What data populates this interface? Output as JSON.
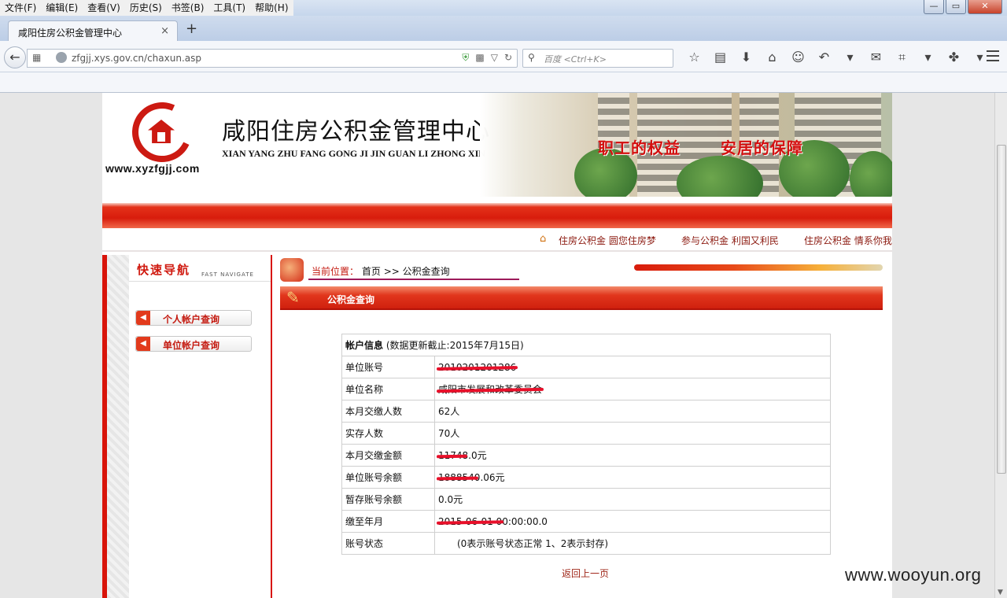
{
  "browser": {
    "menu": [
      "文件(F)",
      "编辑(E)",
      "查看(V)",
      "历史(S)",
      "书签(B)",
      "工具(T)",
      "帮助(H)"
    ],
    "window_controls": {
      "minimize": "—",
      "restore": "▭",
      "close": "✕"
    },
    "tab_title": "咸阳住房公积金管理中心",
    "tab_close": "×",
    "new_tab": "+",
    "url": "zfgjj.xys.gov.cn/chaxun.asp",
    "search_placeholder": "百度 <Ctrl+K>",
    "toolbar_icons": [
      "bookmark-star-icon",
      "reading-list-icon",
      "download-icon",
      "home-icon",
      "emoji-icon",
      "undo-icon",
      "dropdown-icon",
      "chat-icon",
      "crop-icon",
      "dropdown-icon",
      "extension-icon",
      "dropdown-icon"
    ]
  },
  "site": {
    "url_text": "www.xyzfgjj.com",
    "title": "咸阳住房公积金管理中心",
    "pinyin": "XIAN YANG ZHU FANG GONG JI JIN GUAN LI ZHONG XIN",
    "slogan_left": "职工的权益",
    "slogan_right": "安居的保障",
    "taglines": [
      "住房公积金 圆您住房梦",
      "参与公积金 利国又利民",
      "住房公积金 情系你我"
    ]
  },
  "nav": {
    "title": "快速导航",
    "subtitle": "FAST NAVIGATE",
    "items": [
      "个人帐户查询",
      "单位帐户查询"
    ]
  },
  "breadcrumb": {
    "label": "当前位置：",
    "home": "首页",
    "sep": ">>",
    "current": "公积金查询"
  },
  "section_title": "公积金查询",
  "account": {
    "header": "帐户信息",
    "header_note": "(数据更新截止:2015年7月15日)",
    "rows": [
      {
        "label": "单位账号",
        "value": "2010201201286",
        "redacted": true
      },
      {
        "label": "单位名称",
        "value": "咸阳市发展和改革委员会",
        "redacted": true
      },
      {
        "label": "本月交缴人数",
        "value": "62人",
        "redacted": false
      },
      {
        "label": "实存人数",
        "value": "70人",
        "redacted": false
      },
      {
        "label": "本月交缴金额",
        "value": "11748.0元",
        "redacted": true
      },
      {
        "label": "单位账号余额",
        "value": "1888540.06元",
        "redacted": true
      },
      {
        "label": "暂存账号余额",
        "value": "0.0元",
        "redacted": false
      },
      {
        "label": "缴至年月",
        "value": "2015-06-01 00:00:00.0",
        "redacted": true
      },
      {
        "label": "账号状态",
        "value": "(0表示账号状态正常 1、2表示封存)",
        "redacted": false
      }
    ]
  },
  "back_link": "返回上一页",
  "watermark": "www.wooyun.org"
}
